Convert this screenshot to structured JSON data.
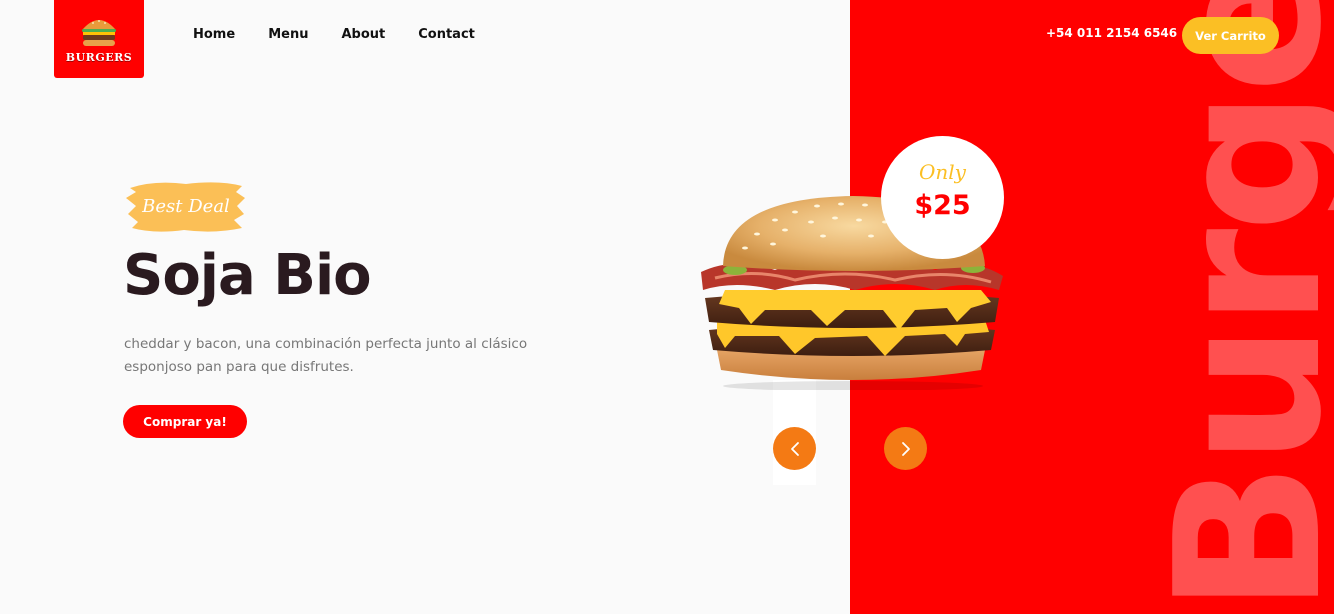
{
  "brand": {
    "logo_text": "BURGERS"
  },
  "nav": {
    "items": [
      {
        "label": "Home"
      },
      {
        "label": "Menu"
      },
      {
        "label": "About"
      },
      {
        "label": "Contact"
      }
    ]
  },
  "header": {
    "phone": "+54 011 2154 6546",
    "cart_label": "Ver Carrito"
  },
  "hero": {
    "badge": "Best Deal",
    "title": "Soja Bio",
    "description": "cheddar y bacon, una combinación perfecta junto al clásico esponjoso pan para que disfrutes.",
    "cta_label": "Comprar ya!",
    "price_prefix": "Only",
    "price": "$25",
    "background_word": "Burger"
  },
  "icons": {
    "prev": "chevron-left-icon",
    "next": "chevron-right-icon"
  },
  "colors": {
    "brand_red": "#ff0000",
    "accent_yellow": "#fbbf24",
    "arrow_orange": "#f47a14",
    "title_dark": "#2a1a1f"
  }
}
